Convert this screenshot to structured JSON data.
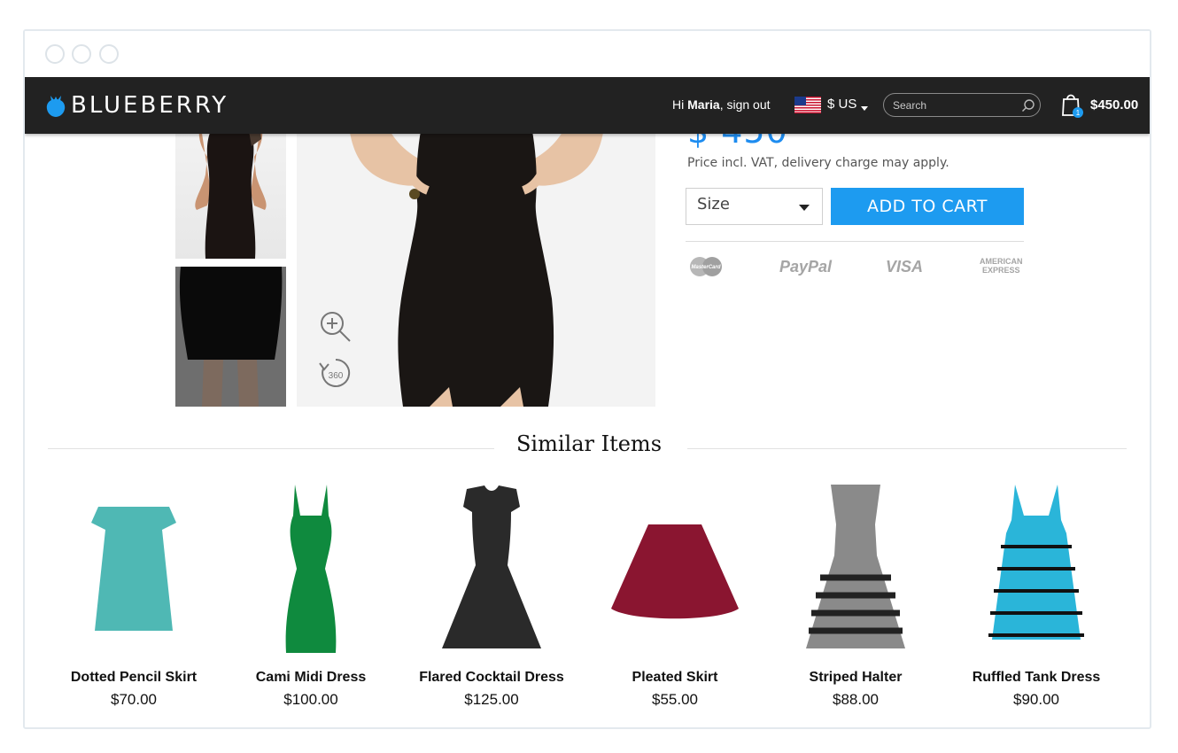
{
  "header": {
    "logo": "BLUEBERRY",
    "greeting_prefix": "Hi ",
    "user_name": "Maria",
    "signout": ", sign out",
    "currency": "$ US",
    "search_placeholder": "Search",
    "cart_badge": "1",
    "cart_total": "$450.00"
  },
  "product": {
    "price": "$ 450",
    "price_note": "Price incl. VAT, delivery charge may apply.",
    "size_label": "Size",
    "add_to_cart": "ADD TO CART",
    "payment": {
      "mastercard": "MasterCard",
      "paypal": "PayPal",
      "visa": "VISA",
      "amex_line1": "AMERICAN",
      "amex_line2": "EXPRESS"
    },
    "rotate_label": "360"
  },
  "similar": {
    "title": "Similar Items",
    "items": [
      {
        "name": "Dotted Pencil Skirt",
        "price": "$70.00",
        "color": "#4fb8b4"
      },
      {
        "name": "Cami Midi Dress",
        "price": "$100.00",
        "color": "#0f8a3e"
      },
      {
        "name": "Flared Cocktail Dress",
        "price": "$125.00",
        "color": "#2a2a2a"
      },
      {
        "name": "Pleated Skirt",
        "price": "$55.00",
        "color": "#8a1530"
      },
      {
        "name": "Striped Halter",
        "price": "$88.00",
        "color": "#8a8a8a"
      },
      {
        "name": "Ruffled Tank Dress",
        "price": "$90.00",
        "color": "#2ab5d9"
      }
    ]
  },
  "colors": {
    "accent": "#1d9bf0",
    "navbar": "#222222"
  }
}
